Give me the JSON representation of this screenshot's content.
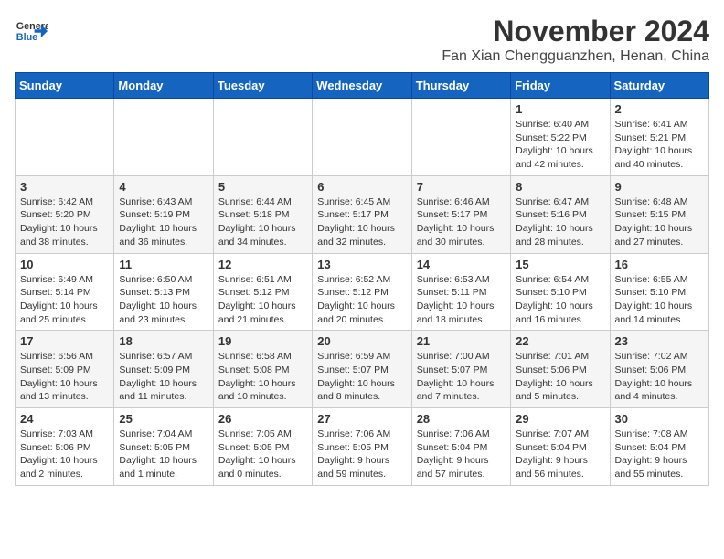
{
  "header": {
    "logo_line1": "General",
    "logo_line2": "Blue",
    "month": "November 2024",
    "location": "Fan Xian Chengguanzhen, Henan, China"
  },
  "days_of_week": [
    "Sunday",
    "Monday",
    "Tuesday",
    "Wednesday",
    "Thursday",
    "Friday",
    "Saturday"
  ],
  "weeks": [
    [
      {
        "day": "",
        "info": ""
      },
      {
        "day": "",
        "info": ""
      },
      {
        "day": "",
        "info": ""
      },
      {
        "day": "",
        "info": ""
      },
      {
        "day": "",
        "info": ""
      },
      {
        "day": "1",
        "info": "Sunrise: 6:40 AM\nSunset: 5:22 PM\nDaylight: 10 hours\nand 42 minutes."
      },
      {
        "day": "2",
        "info": "Sunrise: 6:41 AM\nSunset: 5:21 PM\nDaylight: 10 hours\nand 40 minutes."
      }
    ],
    [
      {
        "day": "3",
        "info": "Sunrise: 6:42 AM\nSunset: 5:20 PM\nDaylight: 10 hours\nand 38 minutes."
      },
      {
        "day": "4",
        "info": "Sunrise: 6:43 AM\nSunset: 5:19 PM\nDaylight: 10 hours\nand 36 minutes."
      },
      {
        "day": "5",
        "info": "Sunrise: 6:44 AM\nSunset: 5:18 PM\nDaylight: 10 hours\nand 34 minutes."
      },
      {
        "day": "6",
        "info": "Sunrise: 6:45 AM\nSunset: 5:17 PM\nDaylight: 10 hours\nand 32 minutes."
      },
      {
        "day": "7",
        "info": "Sunrise: 6:46 AM\nSunset: 5:17 PM\nDaylight: 10 hours\nand 30 minutes."
      },
      {
        "day": "8",
        "info": "Sunrise: 6:47 AM\nSunset: 5:16 PM\nDaylight: 10 hours\nand 28 minutes."
      },
      {
        "day": "9",
        "info": "Sunrise: 6:48 AM\nSunset: 5:15 PM\nDaylight: 10 hours\nand 27 minutes."
      }
    ],
    [
      {
        "day": "10",
        "info": "Sunrise: 6:49 AM\nSunset: 5:14 PM\nDaylight: 10 hours\nand 25 minutes."
      },
      {
        "day": "11",
        "info": "Sunrise: 6:50 AM\nSunset: 5:13 PM\nDaylight: 10 hours\nand 23 minutes."
      },
      {
        "day": "12",
        "info": "Sunrise: 6:51 AM\nSunset: 5:12 PM\nDaylight: 10 hours\nand 21 minutes."
      },
      {
        "day": "13",
        "info": "Sunrise: 6:52 AM\nSunset: 5:12 PM\nDaylight: 10 hours\nand 20 minutes."
      },
      {
        "day": "14",
        "info": "Sunrise: 6:53 AM\nSunset: 5:11 PM\nDaylight: 10 hours\nand 18 minutes."
      },
      {
        "day": "15",
        "info": "Sunrise: 6:54 AM\nSunset: 5:10 PM\nDaylight: 10 hours\nand 16 minutes."
      },
      {
        "day": "16",
        "info": "Sunrise: 6:55 AM\nSunset: 5:10 PM\nDaylight: 10 hours\nand 14 minutes."
      }
    ],
    [
      {
        "day": "17",
        "info": "Sunrise: 6:56 AM\nSunset: 5:09 PM\nDaylight: 10 hours\nand 13 minutes."
      },
      {
        "day": "18",
        "info": "Sunrise: 6:57 AM\nSunset: 5:09 PM\nDaylight: 10 hours\nand 11 minutes."
      },
      {
        "day": "19",
        "info": "Sunrise: 6:58 AM\nSunset: 5:08 PM\nDaylight: 10 hours\nand 10 minutes."
      },
      {
        "day": "20",
        "info": "Sunrise: 6:59 AM\nSunset: 5:07 PM\nDaylight: 10 hours\nand 8 minutes."
      },
      {
        "day": "21",
        "info": "Sunrise: 7:00 AM\nSunset: 5:07 PM\nDaylight: 10 hours\nand 7 minutes."
      },
      {
        "day": "22",
        "info": "Sunrise: 7:01 AM\nSunset: 5:06 PM\nDaylight: 10 hours\nand 5 minutes."
      },
      {
        "day": "23",
        "info": "Sunrise: 7:02 AM\nSunset: 5:06 PM\nDaylight: 10 hours\nand 4 minutes."
      }
    ],
    [
      {
        "day": "24",
        "info": "Sunrise: 7:03 AM\nSunset: 5:06 PM\nDaylight: 10 hours\nand 2 minutes."
      },
      {
        "day": "25",
        "info": "Sunrise: 7:04 AM\nSunset: 5:05 PM\nDaylight: 10 hours\nand 1 minute."
      },
      {
        "day": "26",
        "info": "Sunrise: 7:05 AM\nSunset: 5:05 PM\nDaylight: 10 hours\nand 0 minutes."
      },
      {
        "day": "27",
        "info": "Sunrise: 7:06 AM\nSunset: 5:05 PM\nDaylight: 9 hours\nand 59 minutes."
      },
      {
        "day": "28",
        "info": "Sunrise: 7:06 AM\nSunset: 5:04 PM\nDaylight: 9 hours\nand 57 minutes."
      },
      {
        "day": "29",
        "info": "Sunrise: 7:07 AM\nSunset: 5:04 PM\nDaylight: 9 hours\nand 56 minutes."
      },
      {
        "day": "30",
        "info": "Sunrise: 7:08 AM\nSunset: 5:04 PM\nDaylight: 9 hours\nand 55 minutes."
      }
    ]
  ]
}
